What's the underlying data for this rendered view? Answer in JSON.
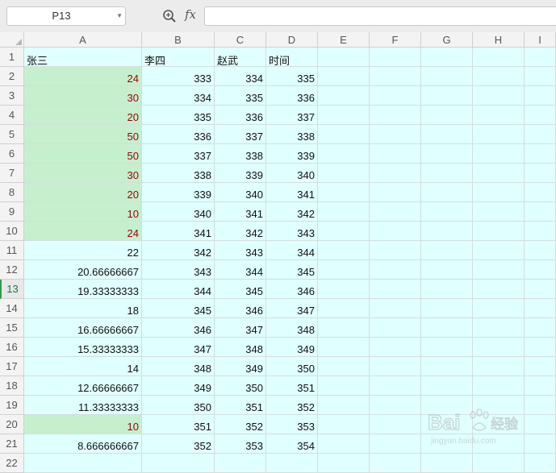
{
  "name_box": {
    "value": "P13"
  },
  "formula_bar": {
    "fx_label": "fx",
    "value": ""
  },
  "columns": [
    "A",
    "B",
    "C",
    "D",
    "E",
    "F",
    "G",
    "H",
    "I"
  ],
  "active_row": "13",
  "rows": [
    {
      "num": "1",
      "a": "张三",
      "b": "李四",
      "c": "赵武",
      "d": "时间",
      "header_row": true
    },
    {
      "num": "2",
      "a": "24",
      "b": "333",
      "c": "334",
      "d": "335",
      "highlight": true
    },
    {
      "num": "3",
      "a": "30",
      "b": "334",
      "c": "335",
      "d": "336",
      "highlight": true
    },
    {
      "num": "4",
      "a": "20",
      "b": "335",
      "c": "336",
      "d": "337",
      "highlight": true
    },
    {
      "num": "5",
      "a": "50",
      "b": "336",
      "c": "337",
      "d": "338",
      "highlight": true
    },
    {
      "num": "6",
      "a": "50",
      "b": "337",
      "c": "338",
      "d": "339",
      "highlight": true
    },
    {
      "num": "7",
      "a": "30",
      "b": "338",
      "c": "339",
      "d": "340",
      "highlight": true
    },
    {
      "num": "8",
      "a": "20",
      "b": "339",
      "c": "340",
      "d": "341",
      "highlight": true
    },
    {
      "num": "9",
      "a": "10",
      "b": "340",
      "c": "341",
      "d": "342",
      "highlight": true
    },
    {
      "num": "10",
      "a": "24",
      "b": "341",
      "c": "342",
      "d": "343",
      "highlight": true
    },
    {
      "num": "11",
      "a": "22",
      "b": "342",
      "c": "343",
      "d": "344"
    },
    {
      "num": "12",
      "a": "20.66666667",
      "b": "343",
      "c": "344",
      "d": "345"
    },
    {
      "num": "13",
      "a": "19.33333333",
      "b": "344",
      "c": "345",
      "d": "346"
    },
    {
      "num": "14",
      "a": "18",
      "b": "345",
      "c": "346",
      "d": "347"
    },
    {
      "num": "15",
      "a": "16.66666667",
      "b": "346",
      "c": "347",
      "d": "348"
    },
    {
      "num": "16",
      "a": "15.33333333",
      "b": "347",
      "c": "348",
      "d": "349"
    },
    {
      "num": "17",
      "a": "14",
      "b": "348",
      "c": "349",
      "d": "350"
    },
    {
      "num": "18",
      "a": "12.66666667",
      "b": "349",
      "c": "350",
      "d": "351"
    },
    {
      "num": "19",
      "a": "11.33333333",
      "b": "350",
      "c": "351",
      "d": "352"
    },
    {
      "num": "20",
      "a": "10",
      "b": "351",
      "c": "352",
      "d": "353",
      "highlight": true
    },
    {
      "num": "21",
      "a": "8.666666667",
      "b": "352",
      "c": "353",
      "d": "354"
    },
    {
      "num": "22",
      "a": "",
      "b": "",
      "c": "",
      "d": ""
    }
  ],
  "watermark": {
    "text": "Bai 经验",
    "sub": "jingyan.baidu.com"
  },
  "colors": {
    "sheet_fill": "#e0ffff",
    "highlight_fill": "#c6efce",
    "highlight_text": "#9c0006",
    "active_row_marker": "#2e9e4e"
  },
  "icons": {
    "zoom": "zoom-magnifier-icon",
    "dropdown": "chevron-down-icon"
  }
}
